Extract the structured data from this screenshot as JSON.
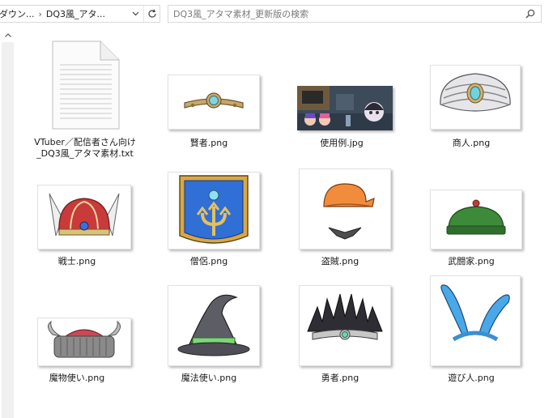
{
  "address_bar": {
    "crumbs": [
      "ダウン...",
      "DQ3風_アタ..."
    ]
  },
  "search": {
    "placeholder": "DQ3風_アタマ素材_更新版の検索"
  },
  "files": [
    {
      "name": "VTuber／配信者さん向け_DQ3風_アタマ素材.txt",
      "line1": "VTuber／配信者さん向け",
      "line2": "_DQ3風_アタマ素材.txt",
      "icon": "text-file-icon"
    },
    {
      "name": "賢者.png"
    },
    {
      "name": "使用例.jpg"
    },
    {
      "name": "商人.png"
    },
    {
      "name": "戦士.png"
    },
    {
      "name": "僧侶.png"
    },
    {
      "name": "盗賊.png"
    },
    {
      "name": "武闘家.png"
    },
    {
      "name": "魔物使い.png"
    },
    {
      "name": "魔法使い.png"
    },
    {
      "name": "勇者.png"
    },
    {
      "name": "遊び人.png"
    }
  ]
}
